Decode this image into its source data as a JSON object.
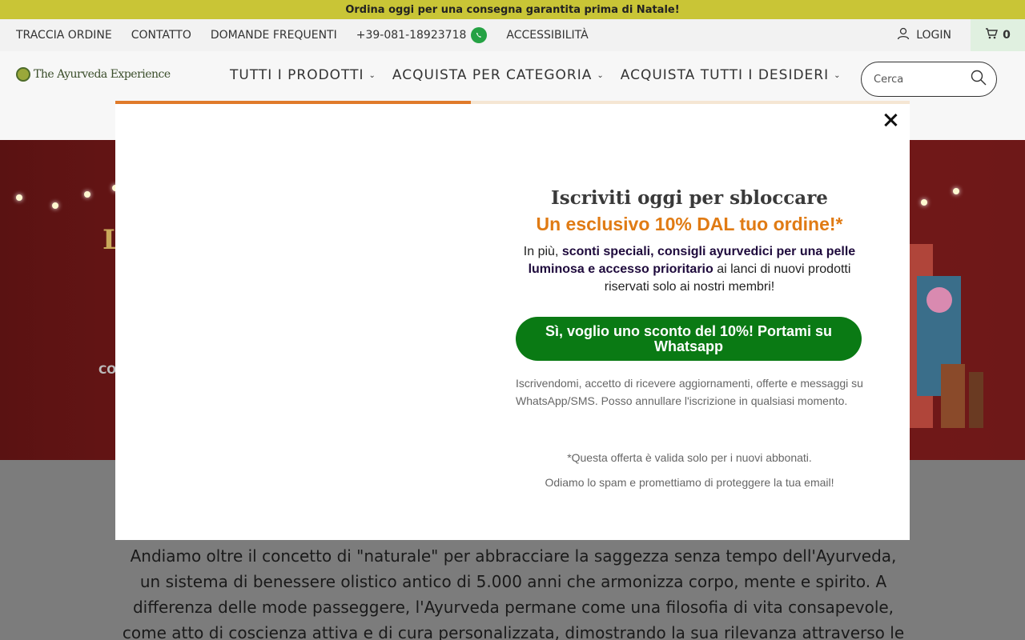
{
  "announcement": "Ordina oggi per una consegna garantita prima di Natale!",
  "topbar": {
    "links": [
      "TRACCIA ORDINE",
      "CONTATTO",
      "DOMANDE FREQUENTI",
      "+39-081-18923718",
      "ACCESSIBILITÀ"
    ],
    "login": "LOGIN",
    "cart_count": "0"
  },
  "header": {
    "logo_text": "The Ayurveda Experience",
    "nav": [
      "TUTTI I PRODOTTI",
      "ACQUISTA PER CATEGORIA",
      "ACQUISTA TUTTI I DESIDERI"
    ],
    "search_placeholder": "Cerca"
  },
  "hero": {
    "title_fragment": "L",
    "subtitle_fragment": "CO"
  },
  "body": {
    "paragraph": "Andiamo oltre il concetto di \"naturale\" per abbracciare la saggezza senza tempo dell'Ayurveda, un sistema di benessere olistico antico di 5.000 anni che armonizza corpo, mente e spirito. A differenza delle mode passeggere, l'Ayurveda permane come una filosofia di vita consapevole, come atto di coscienza attiva e di cura personalizzata, dimostrando la sua rilevanza attraverso le generazioni. La sua convinzione unica che"
  },
  "modal": {
    "heading": "Iscriviti oggi per sbloccare",
    "offer_headline": "Un esclusivo 10% DAL tuo ordine!*",
    "desc_prefix": "In più, ",
    "desc_bold": "sconti speciali, consigli ayurvedici per una pelle luminosa e accesso prioritario",
    "desc_suffix": " ai lanci di nuovi prodotti riservati solo ai nostri membri!",
    "cta_label": "Sì, voglio uno sconto del 10%! Portami su Whatsapp",
    "consent": "Iscrivendomi, accetto di ricevere aggiornamenti, offerte e messaggi su WhatsApp/SMS. Posso annullare l'iscrizione in qualsiasi momento.",
    "offer_note": "*Questa offerta è valida solo per i nuovi abbonati.",
    "spam_note": "Odiamo lo spam e promettiamo di proteggere la tua email!"
  },
  "colors": {
    "announcement_bg": "#c9c536",
    "cta_bg": "#0a7a14",
    "offer_headline": "#e07b14",
    "hero_bg": "#7a1a1a"
  }
}
